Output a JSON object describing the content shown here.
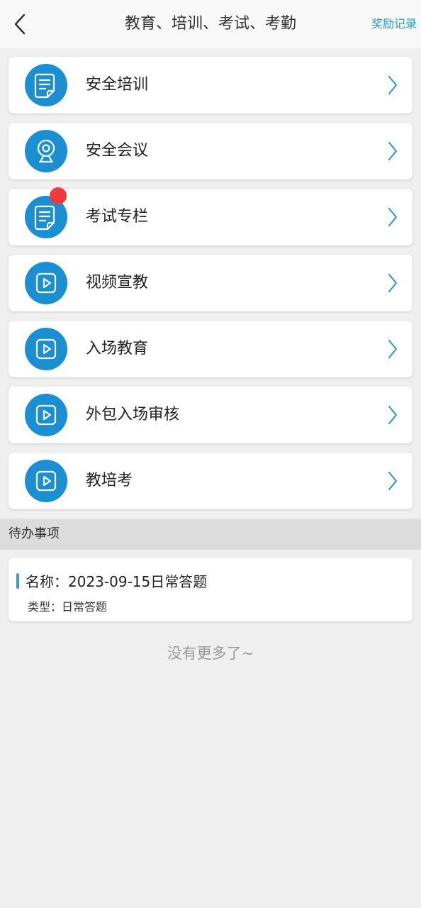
{
  "header": {
    "title": "教育、培训、考试、考勤",
    "reward_link": "奖励记录",
    "back_icon": "chevron-left-icon"
  },
  "menu": {
    "items": [
      {
        "label": "安全培训",
        "icon": "document-icon",
        "badge": false
      },
      {
        "label": "安全会议",
        "icon": "webcam-icon",
        "badge": false
      },
      {
        "label": "考试专栏",
        "icon": "document-icon",
        "badge": true
      },
      {
        "label": "视频宣教",
        "icon": "play-icon",
        "badge": false
      },
      {
        "label": "入场教育",
        "icon": "play-icon",
        "badge": false
      },
      {
        "label": "外包入场审核",
        "icon": "play-icon",
        "badge": false
      },
      {
        "label": "教培考",
        "icon": "play-icon",
        "badge": false
      }
    ]
  },
  "todo": {
    "section_title": "待办事项",
    "items": [
      {
        "name_label": "名称：",
        "name": "2023-09-15日常答题",
        "type_label": "类型：",
        "type": "日常答题"
      }
    ]
  },
  "footer": {
    "no_more_text": "没有更多了~"
  },
  "colors": {
    "accent": "#1a8fd4",
    "link": "#1a9bd8",
    "badge": "#f23a3a",
    "background": "#efefef"
  }
}
